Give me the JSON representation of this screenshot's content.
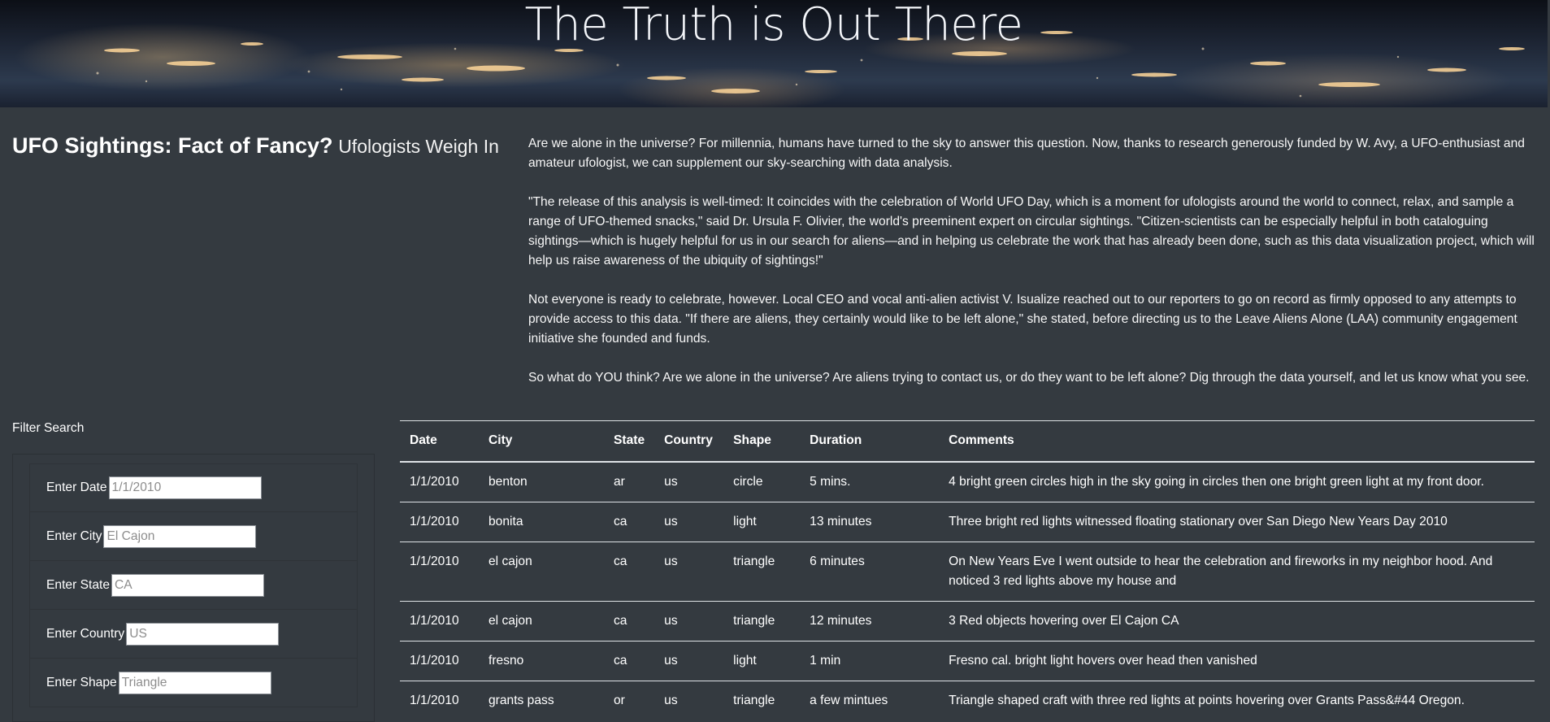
{
  "hero": {
    "title": "The Truth is Out There"
  },
  "story": {
    "title": "UFO Sightings: Fact of Fancy?",
    "subtitle": "Ufologists Weigh In",
    "paragraphs": [
      "Are we alone in the universe? For millennia, humans have turned to the sky to answer this question. Now, thanks to research generously funded by W. Avy, a UFO-enthusiast and amateur ufologist, we can supplement our sky-searching with data analysis.",
      "\"The release of this analysis is well-timed: It coincides with the celebration of World UFO Day, which is a moment for ufologists around the world to connect, relax, and sample a range of UFO-themed snacks,\" said Dr. Ursula F. Olivier, the world's preeminent expert on circular sightings. \"Citizen-scientists can be especially helpful in both cataloguing sightings—which is hugely helpful for us in our search for aliens—and in helping us celebrate the work that has already been done, such as this data visualization project, which will help us raise awareness of the ubiquity of sightings!\"",
      "Not everyone is ready to celebrate, however. Local CEO and vocal anti-alien activist V. Isualize reached out to our reporters to go on record as firmly opposed to any attempts to provide access to this data. \"If there are aliens, they certainly would like to be left alone,\" she stated, before directing us to the Leave Aliens Alone (LAA) community engagement initiative she founded and funds.",
      "So what do YOU think? Are we alone in the universe? Are aliens trying to contact us, or do they want to be left alone? Dig through the data yourself, and let us know what you see."
    ]
  },
  "filter": {
    "title": "Filter Search",
    "fields": [
      {
        "label": "Enter Date",
        "placeholder": "1/1/2010",
        "value": ""
      },
      {
        "label": "Enter City",
        "placeholder": "El Cajon",
        "value": ""
      },
      {
        "label": "Enter State",
        "placeholder": "CA",
        "value": ""
      },
      {
        "label": "Enter Country",
        "placeholder": "US",
        "value": ""
      },
      {
        "label": "Enter Shape",
        "placeholder": "Triangle",
        "value": ""
      }
    ]
  },
  "table": {
    "columns": [
      "Date",
      "City",
      "State",
      "Country",
      "Shape",
      "Duration",
      "Comments"
    ],
    "rows": [
      [
        "1/1/2010",
        "benton",
        "ar",
        "us",
        "circle",
        "5 mins.",
        "4 bright green circles high in the sky going in circles then one bright green light at my front door."
      ],
      [
        "1/1/2010",
        "bonita",
        "ca",
        "us",
        "light",
        "13 minutes",
        "Three bright red lights witnessed floating stationary over San Diego New Years Day 2010"
      ],
      [
        "1/1/2010",
        "el cajon",
        "ca",
        "us",
        "triangle",
        "6 minutes",
        "On New Years Eve I went outside to hear the celebration and fireworks in my neighbor hood. And noticed 3 red lights above my house and"
      ],
      [
        "1/1/2010",
        "el cajon",
        "ca",
        "us",
        "triangle",
        "12 minutes",
        "3 Red objects hovering over El Cajon CA"
      ],
      [
        "1/1/2010",
        "fresno",
        "ca",
        "us",
        "light",
        "1 min",
        "Fresno cal. bright light hovers over head then vanished"
      ],
      [
        "1/1/2010",
        "grants pass",
        "or",
        "us",
        "triangle",
        "a few mintues",
        "Triangle shaped craft with three red lights at points hovering over Grants Pass&#44 Oregon."
      ]
    ]
  }
}
